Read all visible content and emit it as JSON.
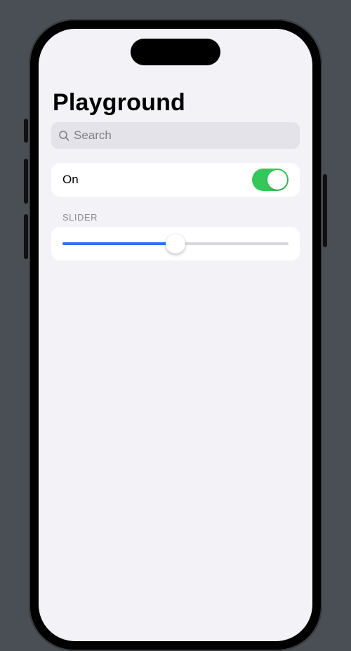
{
  "header": {
    "title": "Playground"
  },
  "search": {
    "placeholder": "Search"
  },
  "toggle_row": {
    "label": "On",
    "value": true,
    "on_color": "#35c759"
  },
  "slider_section": {
    "header": "SLIDER",
    "value": 0.5,
    "track_color": "#2f6ef6"
  }
}
